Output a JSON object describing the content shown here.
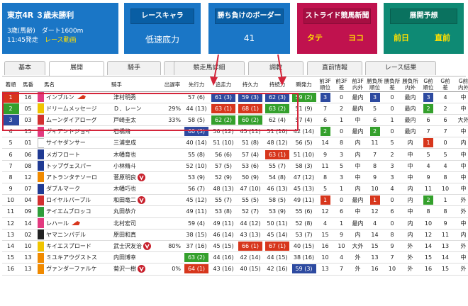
{
  "race": {
    "title": "東京4R ３歳未勝利",
    "cond": "3歳(馬齢)　ダート1600m",
    "time": "11:45発走",
    "movie": "レース動画"
  },
  "chara": {
    "head": "レースキャラ",
    "value": "低速底力"
  },
  "border": {
    "head": "勝ち負けのボーダー",
    "value": "41"
  },
  "stride": {
    "head": "ストライド競馬新聞",
    "a": "タテ",
    "b": "ヨコ"
  },
  "tenkai": {
    "head": "展開予想",
    "a": "前日",
    "b": "直前"
  },
  "tabs": [
    "基本",
    "展開",
    "騎手",
    "外厩",
    "競走馬詳細",
    "調教",
    "直前情報",
    "レース結果"
  ],
  "active_tab": "展開",
  "headers": [
    "着順",
    "馬番",
    "",
    "馬名",
    "騎手",
    "出遅率",
    "先行力",
    "追走力",
    "持久力",
    "持続力",
    "瞬発力",
    "前3F\n順位",
    "前3F\n差",
    "前3F\n内外",
    "勝負所\n順位",
    "勝負所\n差",
    "勝負所\n内外",
    "G前\n順位",
    "G前\n差",
    "G前\n内外"
  ],
  "colors": {
    "blue": "#2d4aa0",
    "red": "#d7361c",
    "green": "#34a02c",
    "highlight": "#d4243a"
  },
  "rows": [
    {
      "rank": "1",
      "no": "16",
      "wk": "#e23a7f",
      "name": "インブルン",
      "cap": true,
      "jockey": "津村明秀",
      "deo": "",
      "senko": "57 (6)",
      "senkoC": "",
      "tsuiso": "61 (3)",
      "tsuisoC": "blue",
      "jikyu": "59 (3)",
      "jikyuC": "blue",
      "jizoku": "62 (3)",
      "jizokuC": "blue",
      "shunpatsu": "59 (2)",
      "shunpatsuC": "green",
      "f1": "3",
      "f1C": "blue",
      "f2": "0",
      "f3": "最内",
      "s1": "3",
      "s1C": "blue",
      "s2": "0",
      "s3": "最内",
      "g1": "3",
      "g1C": "blue",
      "g2": "4",
      "g3": "中"
    },
    {
      "rank": "2",
      "no": "05",
      "wk": "#f0c400",
      "name": "ドリームメッセージ",
      "cap": false,
      "jockey": "Ｄ．レーン",
      "deo": "29%",
      "senko": "44 (13)",
      "senkoC": "",
      "tsuiso": "63 (1)",
      "tsuisoC": "red",
      "jikyu": "68 (1)",
      "jikyuC": "red",
      "jizoku": "63 (2)",
      "jizokuC": "green",
      "shunpatsu": "51 (9)",
      "shunpatsuC": "",
      "f1": "7",
      "f1C": "",
      "f2": "2",
      "f3": "最内",
      "s1": "5",
      "s1C": "",
      "s2": "0",
      "s3": "最内",
      "g1": "2",
      "g1C": "green",
      "g2": "2",
      "g3": "中"
    },
    {
      "rank": "3",
      "no": "03",
      "wk": "#d23030",
      "name": "ムーンダイアローグ",
      "cap": false,
      "jockey": "戸崎圭太",
      "deo": "33%",
      "senko": "58 (5)",
      "senkoC": "",
      "tsuiso": "62 (2)",
      "tsuisoC": "green",
      "jikyu": "60 (2)",
      "jikyuC": "green",
      "jizoku": "62 (4)",
      "jizokuC": "",
      "shunpatsu": "57 (4)",
      "shunpatsuC": "",
      "f1": "6",
      "f1C": "",
      "f2": "1",
      "f3": "中",
      "s1": "6",
      "s1C": "",
      "s2": "1",
      "s3": "最内",
      "g1": "6",
      "g1C": "",
      "g2": "6",
      "g3": "大外"
    },
    {
      "rank": "4",
      "no": "15",
      "wk": "#e23a7f",
      "name": "ヴィアントジョイ",
      "cap": false,
      "jockey": "石橋脩",
      "deo": "",
      "senko": "60 (3)",
      "senkoC": "blue",
      "tsuiso": "50 (12)",
      "tsuisoC": "",
      "jikyu": "45 (11)",
      "jikyuC": "",
      "jizoku": "51 (10)",
      "jizokuC": "",
      "shunpatsu": "42 (14)",
      "shunpatsuC": "",
      "f1": "2",
      "f1C": "green",
      "f2": "0",
      "f3": "最内",
      "s1": "2",
      "s1C": "green",
      "s2": "0",
      "s3": "最内",
      "g1": "7",
      "g1C": "",
      "g2": "7",
      "g3": "中"
    },
    {
      "rank": "5",
      "no": "01",
      "wk": "#ffffff",
      "name": "サイヤダンサー",
      "cap": false,
      "jockey": "三浦皇成",
      "deo": "",
      "senko": "40 (14)",
      "senkoC": "",
      "tsuiso": "51 (10)",
      "tsuisoC": "",
      "jikyu": "51 (8)",
      "jikyuC": "",
      "jizoku": "48 (12)",
      "jizokuC": "",
      "shunpatsu": "56 (5)",
      "shunpatsuC": "",
      "f1": "14",
      "f1C": "",
      "f2": "8",
      "f3": "内",
      "s1": "11",
      "s1C": "",
      "s2": "5",
      "s3": "内",
      "g1": "1",
      "g1C": "red",
      "g2": "0",
      "g3": "内"
    },
    {
      "rank": "6",
      "no": "06",
      "wk": "#1f3a93",
      "name": "メガフロート",
      "cap": false,
      "jockey": "木幡育也",
      "deo": "",
      "senko": "55 (8)",
      "senkoC": "",
      "tsuiso": "56 (6)",
      "tsuisoC": "",
      "jikyu": "57 (4)",
      "jikyuC": "",
      "jizoku": "63 (1)",
      "jizokuC": "red",
      "shunpatsu": "51 (10)",
      "shunpatsuC": "",
      "f1": "9",
      "f1C": "",
      "f2": "3",
      "f3": "内",
      "s1": "7",
      "s1C": "",
      "s2": "2",
      "s3": "中",
      "g1": "5",
      "g1C": "",
      "g2": "5",
      "g3": "中"
    },
    {
      "rank": "7",
      "no": "08",
      "wk": "#1f3a93",
      "name": "トップヴェスパー",
      "cap": false,
      "jockey": "小林脩斗",
      "deo": "",
      "senko": "52 (10)",
      "senkoC": "",
      "tsuiso": "57 (5)",
      "tsuisoC": "",
      "jikyu": "53 (6)",
      "jikyuC": "",
      "jizoku": "55 (7)",
      "jizokuC": "",
      "shunpatsu": "58 (3)",
      "shunpatsuC": "",
      "f1": "11",
      "f1C": "",
      "f2": "5",
      "f3": "中",
      "s1": "8",
      "s1C": "",
      "s2": "3",
      "s3": "中",
      "g1": "4",
      "g1C": "",
      "g2": "4",
      "g3": "中"
    },
    {
      "rank": "8",
      "no": "12",
      "wk": "#f08a00",
      "name": "アトランタテソーロ",
      "cap": false,
      "vicon": true,
      "jockey": "菅原明良",
      "deo": "",
      "senko": "53 (9)",
      "senkoC": "",
      "tsuiso": "52 (9)",
      "tsuisoC": "",
      "jikyu": "50 (9)",
      "jikyuC": "",
      "jizoku": "54 (8)",
      "jizokuC": "",
      "shunpatsu": "47 (12)",
      "shunpatsuC": "",
      "f1": "8",
      "f1C": "",
      "f2": "3",
      "f3": "中",
      "s1": "9",
      "s1C": "",
      "s2": "3",
      "s3": "中",
      "g1": "9",
      "g1C": "",
      "g2": "8",
      "g3": "中"
    },
    {
      "rank": "9",
      "no": "07",
      "wk": "#1f3a93",
      "name": "ダブルマーク",
      "cap": false,
      "jockey": "木幡巧也",
      "deo": "",
      "senko": "56 (7)",
      "senkoC": "",
      "tsuiso": "48 (13)",
      "tsuisoC": "",
      "jikyu": "47 (10)",
      "jikyuC": "",
      "jizoku": "46 (13)",
      "jizokuC": "",
      "shunpatsu": "45 (13)",
      "shunpatsuC": "",
      "f1": "5",
      "f1C": "",
      "f2": "1",
      "f3": "内",
      "s1": "10",
      "s1C": "",
      "s2": "4",
      "s3": "内",
      "g1": "11",
      "g1C": "",
      "g2": "10",
      "g3": "中"
    },
    {
      "rank": "10",
      "no": "04",
      "wk": "#d23030",
      "name": "ロイヤルパープル",
      "cap": false,
      "vicon": true,
      "jockey": "和田竜二",
      "deo": "",
      "senko": "45 (12)",
      "senkoC": "",
      "tsuiso": "55 (7)",
      "tsuisoC": "",
      "jikyu": "55 (5)",
      "jikyuC": "",
      "jizoku": "58 (5)",
      "jizokuC": "",
      "shunpatsu": "49 (11)",
      "shunpatsuC": "",
      "f1": "1",
      "f1C": "red",
      "f2": "0",
      "f3": "最内",
      "s1": "1",
      "s1C": "red",
      "s2": "0",
      "s3": "内",
      "g1": "2",
      "g1C": "green",
      "g2": "1",
      "g3": "外"
    },
    {
      "rank": "11",
      "no": "09",
      "wk": "#2e9d3a",
      "name": "テイエムブロッコ",
      "cap": false,
      "jockey": "丸田恭介",
      "deo": "",
      "senko": "49 (11)",
      "senkoC": "",
      "tsuiso": "53 (8)",
      "tsuisoC": "",
      "jikyu": "52 (7)",
      "jikyuC": "",
      "jizoku": "53 (9)",
      "jizokuC": "",
      "shunpatsu": "55 (6)",
      "shunpatsuC": "",
      "f1": "12",
      "f1C": "",
      "f2": "6",
      "f3": "中",
      "s1": "12",
      "s1C": "",
      "s2": "6",
      "s3": "中",
      "g1": "8",
      "g1C": "",
      "g2": "8",
      "g3": "外"
    },
    {
      "rank": "12",
      "no": "14",
      "wk": "#e23a7f",
      "name": "レハール",
      "cap": true,
      "jockey": "北村宏司",
      "deo": "",
      "senko": "59 (4)",
      "senkoC": "",
      "tsuiso": "49 (11)",
      "tsuisoC": "",
      "jikyu": "44 (12)",
      "jikyuC": "",
      "jizoku": "50 (11)",
      "jizokuC": "",
      "shunpatsu": "52 (8)",
      "shunpatsuC": "",
      "f1": "4",
      "f1C": "",
      "f2": "1",
      "f3": "最内",
      "s1": "4",
      "s1C": "",
      "s2": "0",
      "s3": "内",
      "g1": "10",
      "g1C": "",
      "g2": "9",
      "g3": "中"
    },
    {
      "rank": "13",
      "no": "02",
      "wk": "#222222",
      "name": "ヤマニンパデル",
      "cap": false,
      "jockey": "原田和真",
      "deo": "",
      "senko": "38 (15)",
      "senkoC": "",
      "tsuiso": "46 (14)",
      "tsuisoC": "",
      "jikyu": "43 (13)",
      "jikyuC": "",
      "jizoku": "45 (14)",
      "jizokuC": "",
      "shunpatsu": "53 (7)",
      "shunpatsuC": "",
      "f1": "15",
      "f1C": "",
      "f2": "9",
      "f3": "内",
      "s1": "14",
      "s1C": "",
      "s2": "8",
      "s3": "内",
      "g1": "12",
      "g1C": "",
      "g2": "11",
      "g3": "内"
    },
    {
      "rank": "14",
      "no": "10",
      "wk": "#f0c400",
      "name": "キイエスプロード",
      "cap": false,
      "vicon": true,
      "jockey": "武士沢友治",
      "deo": "80%",
      "senko": "37 (16)",
      "senkoC": "",
      "tsuiso": "45 (15)",
      "tsuisoC": "",
      "jikyu": "66 (1)",
      "jikyuC": "red",
      "jizoku": "67 (1)",
      "jizokuC": "red",
      "shunpatsu": "40 (15)",
      "shunpatsuC": "",
      "f1": "16",
      "f1C": "",
      "f2": "10",
      "f3": "大外",
      "s1": "15",
      "s1C": "",
      "s2": "9",
      "s3": "外",
      "g1": "14",
      "g1C": "",
      "g2": "13",
      "g3": "外"
    },
    {
      "rank": "15",
      "no": "13",
      "wk": "#f08a00",
      "name": "ミユキアウグストス",
      "cap": false,
      "jockey": "内田博幸",
      "deo": "",
      "senko": "63 (2)",
      "senkoC": "green",
      "tsuiso": "44 (16)",
      "tsuisoC": "",
      "jikyu": "42 (14)",
      "jikyuC": "",
      "jizoku": "44 (15)",
      "jizokuC": "",
      "shunpatsu": "38 (16)",
      "shunpatsuC": "",
      "f1": "10",
      "f1C": "",
      "f2": "4",
      "f3": "外",
      "s1": "13",
      "s1C": "",
      "s2": "7",
      "s3": "外",
      "g1": "15",
      "g1C": "",
      "g2": "14",
      "g3": "中"
    },
    {
      "rank": "16",
      "no": "13",
      "wk": "#f08a00",
      "name": "ヴァンダーファルケ",
      "cap": false,
      "vicon": true,
      "jockey": "菊沢一樹",
      "deo": "0%",
      "senko": "64 (1)",
      "senkoC": "red",
      "tsuiso": "43 (16)",
      "tsuisoC": "",
      "jikyu": "40 (15)",
      "jikyuC": "",
      "jizoku": "42 (16)",
      "jizokuC": "",
      "shunpatsu": "59 (3)",
      "shunpatsuC": "blue",
      "f1": "13",
      "f1C": "",
      "f2": "7",
      "f3": "外",
      "s1": "16",
      "s1C": "",
      "s2": "10",
      "s3": "外",
      "g1": "16",
      "g1C": "",
      "g2": "15",
      "g3": "外"
    }
  ]
}
